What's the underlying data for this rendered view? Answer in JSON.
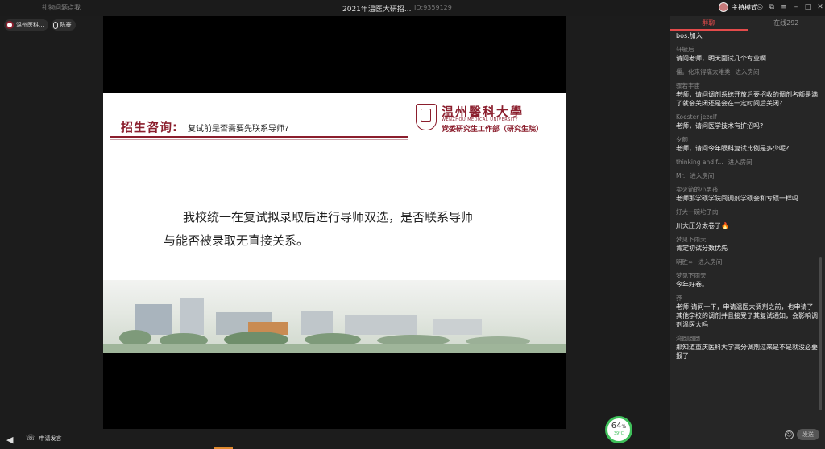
{
  "titlebar": {
    "hint": "礼物问题点我",
    "title": "2021年温医大研招...",
    "meeting_id": "ID:9359129",
    "host_mode": "主持模式",
    "window_buttons": [
      "◎",
      "⧉",
      "≡",
      "–",
      "□",
      "✕"
    ]
  },
  "participants": [
    {
      "label": "温州医科..."
    },
    {
      "label": "陈豪"
    }
  ],
  "slide": {
    "heading": "招生咨询:",
    "question": "复试前是否需要先联系导师?",
    "university_name": "温州醫科大學",
    "university_en": "WENZHOU MEDICAL UNIVERSITY",
    "department": "党委研究生工作部（研究生院）",
    "body": "我校统一在复试拟录取后进行导师双选，是否联系导师与能否被录取无直接关系。"
  },
  "bottom": {
    "apply_label": "申请发言",
    "gauge_pct": "64",
    "gauge_unit": "%",
    "gauge_temp": "39°C"
  },
  "panel": {
    "tabs": [
      "群聊",
      "在线292"
    ],
    "messages": [
      {
        "name": "",
        "text": "bos.加入"
      },
      {
        "name": "轩毓后",
        "text": "请问老师，明天面试几个专业啊"
      },
      {
        "name": "僵。化来得痛太难类",
        "join": "进入房间"
      },
      {
        "name": "骤若宇宙",
        "text": "老师，请问调剂系统开放后要招收的调剂名额是满了就会关闭还是会在一定时间后关闭？"
      },
      {
        "name": "Koester jezelf",
        "text": "老师，请问医学技术有扩招吗?"
      },
      {
        "name": "夕颜",
        "text": "老师，请问今年眼科复试比例是多少呢?"
      },
      {
        "name": "thinking and f...",
        "join": "进入房间"
      },
      {
        "name": "Mr.",
        "join": "进入房间"
      },
      {
        "name": "卖火箭的小男孩",
        "text": "老师那学硕学院间调剂学硕会和专硕一样吗"
      },
      {
        "name": "好大一碗坨子肉",
        "join": ""
      },
      {
        "name": "",
        "text": "川大压分太卷了🔥"
      },
      {
        "name": "梦见下雨天",
        "text": "肯定初试分数优先"
      },
      {
        "name": "明胜∞",
        "join": "进入房间"
      },
      {
        "name": "梦见下雨天",
        "text": "今年好卷。"
      },
      {
        "name": "莽",
        "text": "老师  请问一下，申请温医大调剂之前，也申请了其他学校的调剂并且接受了其复试通知，会影响调剂温医大吗"
      },
      {
        "name": "湾圆圆圆",
        "text": "那知道重庆医科大学高分调剂过来是不是就没必要报了"
      }
    ]
  },
  "input": {
    "emoji": "☺",
    "send_label": "发送"
  },
  "colors": {
    "accent_red": "#e34b4b",
    "university_red": "#8b1e2d",
    "gauge_green": "#3fbf5a"
  }
}
